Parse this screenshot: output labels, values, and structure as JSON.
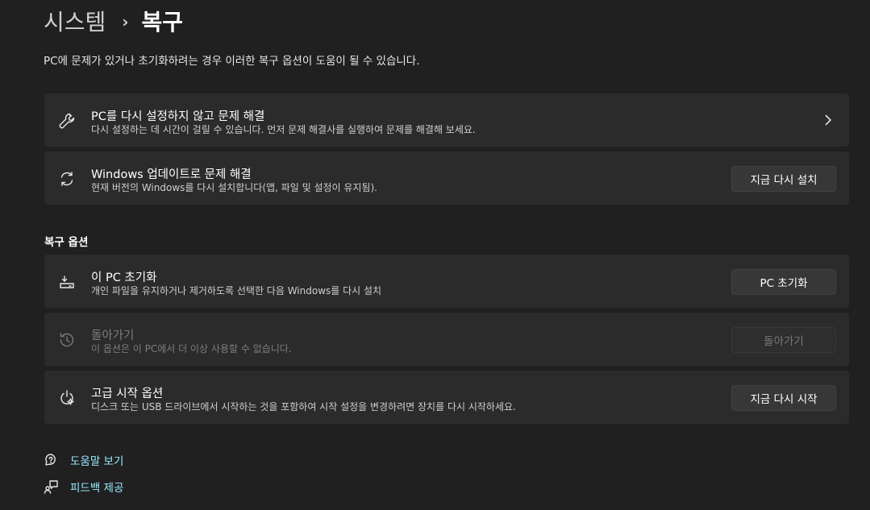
{
  "breadcrumb": {
    "parent": "시스템",
    "separator": "›",
    "current": "복구"
  },
  "intro": "PC에 문제가 있거나 초기화하려는 경우 이러한 복구 옵션이 도움이 될 수 있습니다.",
  "cards": {
    "troubleshoot": {
      "title": "PC를 다시 설정하지 않고 문제 해결",
      "desc": "다시 설정하는 데 시간이 걸릴 수 있습니다. 먼저 문제 해결사를 실행하여 문제를 해결해 보세요.",
      "icon": "wrench-icon"
    },
    "windows_update": {
      "title": "Windows 업데이트로 문제 해결",
      "desc": "현재 버전의 Windows를 다시 설치합니다(앱, 파일 및 설정이 유지됨).",
      "button": "지금 다시 설치",
      "icon": "refresh-icon"
    }
  },
  "recovery_section": {
    "title": "복구 옵션",
    "reset_pc": {
      "title": "이 PC 초기화",
      "desc": "개인 파일을 유지하거나 제거하도록 선택한 다음 Windows를 다시 설치",
      "button": "PC 초기화",
      "icon": "reset-pc-icon"
    },
    "go_back": {
      "title": "돌아가기",
      "desc": "이 옵션은 이 PC에서 더 이상 사용할 수 없습니다.",
      "button": "돌아가기",
      "disabled": true,
      "icon": "history-icon"
    },
    "advanced_startup": {
      "title": "고급 시작 옵션",
      "desc": "디스크 또는 USB 드라이브에서 시작하는 것을 포함하여 시작 설정을 변경하려면 장치를 다시 시작하세요.",
      "button": "지금 다시 시작",
      "icon": "advanced-startup-icon"
    }
  },
  "links": {
    "help": {
      "label": "도움말 보기",
      "icon": "help-icon"
    },
    "feedback": {
      "label": "피드백 제공",
      "icon": "feedback-icon"
    }
  },
  "colors": {
    "background": "#202020",
    "card": "#2b2b2b",
    "button": "#373737",
    "link": "#99ebff"
  }
}
